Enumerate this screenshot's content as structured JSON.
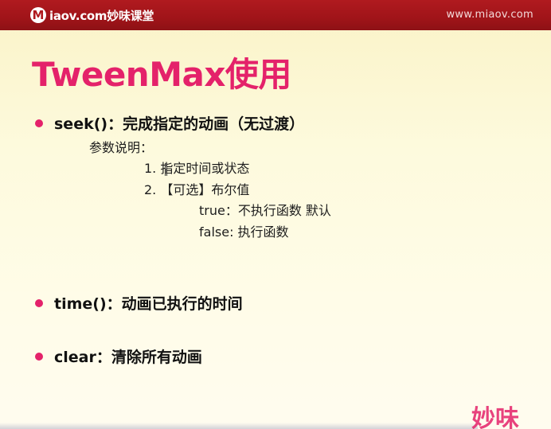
{
  "header": {
    "logo_mark": "M",
    "logo_text": "iaov.com妙味课堂",
    "url": "www.miaov.com"
  },
  "slide": {
    "title": "TweenMax使用",
    "bullets": [
      {
        "label": "seek()：完成指定的动画（无过渡）"
      },
      {
        "label": "time()：动画已执行的时间"
      },
      {
        "label": "clear：清除所有动画"
      }
    ],
    "params": {
      "heading": "参数说明：",
      "item1": "1. 指定时间或状态",
      "item2": "2. 【可选】布尔值",
      "sub_true": "true：不执行函数  默认",
      "sub_false": "false: 执行函数"
    }
  },
  "watermark": "妙味"
}
